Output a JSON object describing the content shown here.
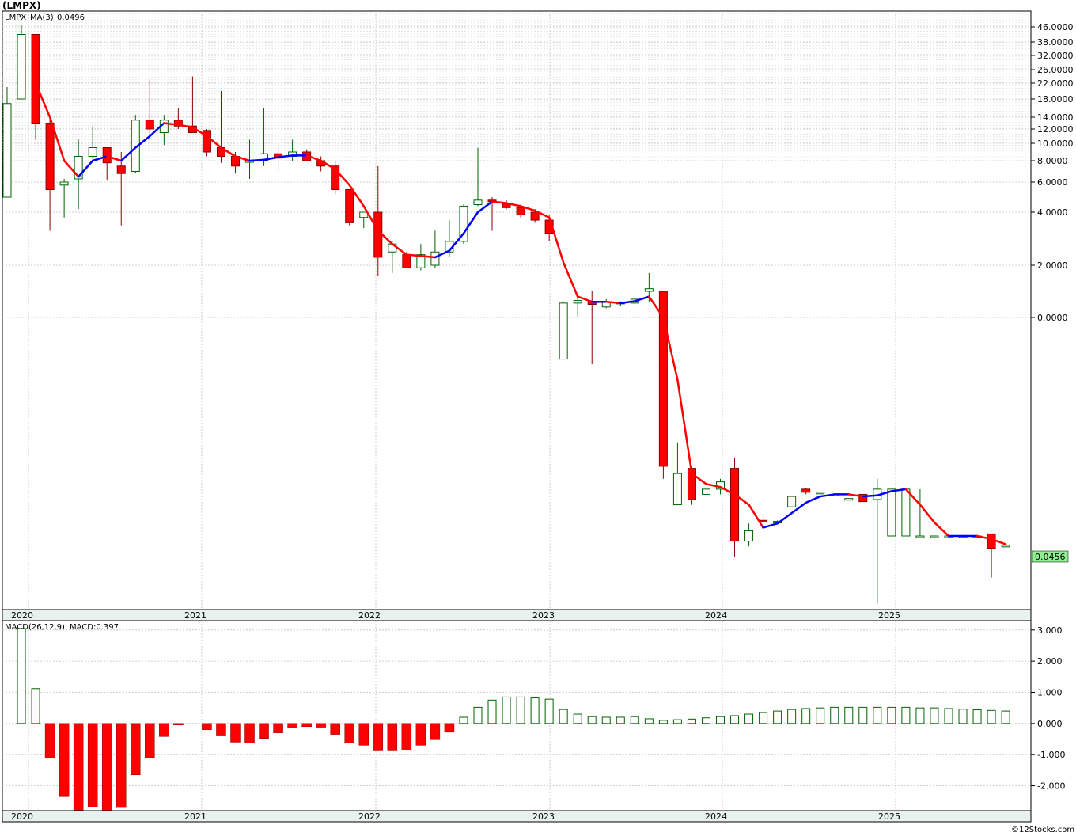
{
  "title": "(LMPX)",
  "footer": "©12Stocks.com",
  "colors": {
    "up": "#006400",
    "down": "#ff0000",
    "ma_up": "#0000ff",
    "ma_down": "#ff0000",
    "grid": "#c0c0c0",
    "axis_bg": "#e8f0f0",
    "price_tag": "#90ee90"
  },
  "chart_data": [
    {
      "type": "candlestick",
      "legend": {
        "symbol": "LMPX",
        "ma_label": "MA(3)",
        "ma_value": "0.0496"
      },
      "last_price_label": "0.0456",
      "ytick_labels": [
        "46.0000",
        "38.0000",
        "32.0000",
        "26.0000",
        "22.0000",
        "18.0000",
        "14.0000",
        "12.0000",
        "10.0000",
        "8.0000",
        "6.0000",
        "4.0000",
        "2.0000",
        "0.0000"
      ],
      "ytick_values": [
        46,
        38,
        32,
        26,
        22,
        18,
        14,
        12,
        10,
        8,
        6,
        4,
        2,
        0
      ],
      "year_labels": [
        "2020",
        "2021",
        "2022",
        "2023",
        "2024",
        "2025"
      ],
      "scale_note": "non-linear price axis",
      "candles": [
        {
          "o": 5.0,
          "h": 21.0,
          "l": 5.0,
          "c": 17.0
        },
        {
          "o": 18.0,
          "h": 50.0,
          "l": 18.0,
          "c": 42.0
        },
        {
          "o": 42.0,
          "h": 42.0,
          "l": 10.5,
          "c": 13.0
        },
        {
          "o": 13.0,
          "h": 13.5,
          "l": 3.3,
          "c": 5.5
        },
        {
          "o": 5.8,
          "h": 6.3,
          "l": 3.8,
          "c": 6.0
        },
        {
          "o": 6.3,
          "h": 10.5,
          "l": 4.2,
          "c": 8.5
        },
        {
          "o": 8.5,
          "h": 12.5,
          "l": 8.2,
          "c": 9.5
        },
        {
          "o": 9.5,
          "h": 9.5,
          "l": 6.2,
          "c": 7.8
        },
        {
          "o": 7.5,
          "h": 9.0,
          "l": 3.5,
          "c": 6.8
        },
        {
          "o": 7.0,
          "h": 14.5,
          "l": 6.8,
          "c": 13.5
        },
        {
          "o": 13.5,
          "h": 23.0,
          "l": 11.0,
          "c": 12.0
        },
        {
          "o": 11.5,
          "h": 14.5,
          "l": 9.8,
          "c": 13.5
        },
        {
          "o": 13.5,
          "h": 16.0,
          "l": 12.0,
          "c": 12.5
        },
        {
          "o": 12.5,
          "h": 24.0,
          "l": 11.5,
          "c": 11.5
        },
        {
          "o": 11.8,
          "h": 12.0,
          "l": 8.5,
          "c": 9.0
        },
        {
          "o": 9.5,
          "h": 20.0,
          "l": 7.8,
          "c": 8.5
        },
        {
          "o": 8.5,
          "h": 9.0,
          "l": 6.8,
          "c": 7.5
        },
        {
          "o": 8.0,
          "h": 10.5,
          "l": 6.3,
          "c": 8.0
        },
        {
          "o": 8.0,
          "h": 16.0,
          "l": 7.5,
          "c": 8.8
        },
        {
          "o": 8.8,
          "h": 9.5,
          "l": 7.0,
          "c": 8.3
        },
        {
          "o": 8.5,
          "h": 10.5,
          "l": 8.0,
          "c": 9.0
        },
        {
          "o": 9.0,
          "h": 9.3,
          "l": 8.0,
          "c": 8.0
        },
        {
          "o": 8.0,
          "h": 8.5,
          "l": 7.0,
          "c": 7.5
        },
        {
          "o": 7.5,
          "h": 8.0,
          "l": 5.2,
          "c": 5.5
        },
        {
          "o": 5.5,
          "h": 5.5,
          "l": 3.5,
          "c": 3.6
        },
        {
          "o": 3.8,
          "h": 4.0,
          "l": 3.4,
          "c": 4.0
        },
        {
          "o": 4.0,
          "h": 7.5,
          "l": 1.6,
          "c": 2.3
        },
        {
          "o": 2.5,
          "h": 2.9,
          "l": 1.7,
          "c": 2.8
        },
        {
          "o": 2.4,
          "h": 2.5,
          "l": 1.9,
          "c": 1.9
        },
        {
          "o": 1.9,
          "h": 2.8,
          "l": 1.8,
          "c": 2.4
        },
        {
          "o": 2.0,
          "h": 3.3,
          "l": 1.9,
          "c": 2.5
        },
        {
          "o": 2.5,
          "h": 3.7,
          "l": 2.3,
          "c": 2.9
        },
        {
          "o": 2.9,
          "h": 4.5,
          "l": 2.8,
          "c": 4.4
        },
        {
          "o": 4.5,
          "h": 9.5,
          "l": 4.4,
          "c": 4.8
        },
        {
          "o": 4.8,
          "h": 5.0,
          "l": 3.3,
          "c": 4.7
        },
        {
          "o": 4.6,
          "h": 4.8,
          "l": 4.2,
          "c": 4.3
        },
        {
          "o": 4.3,
          "h": 4.5,
          "l": 3.8,
          "c": 3.9
        },
        {
          "o": 4.0,
          "h": 4.2,
          "l": 3.6,
          "c": 3.7
        },
        {
          "o": 3.7,
          "h": 3.9,
          "l": 2.9,
          "c": 3.2
        },
        {
          "o": -0.4,
          "h": 0.6,
          "l": -0.4,
          "c": 0.55
        },
        {
          "o": 0.55,
          "h": 0.75,
          "l": 0.0,
          "c": 0.65
        },
        {
          "o": 0.6,
          "h": 1.0,
          "l": -0.45,
          "c": 0.5
        },
        {
          "o": 0.4,
          "h": 0.7,
          "l": 0.35,
          "c": 0.6
        },
        {
          "o": 0.55,
          "h": 0.62,
          "l": 0.45,
          "c": 0.58
        },
        {
          "o": 0.55,
          "h": 0.75,
          "l": 0.5,
          "c": 0.7
        },
        {
          "o": 1.0,
          "h": 1.7,
          "l": 0.6,
          "c": 1.1
        },
        {
          "o": 1.0,
          "h": 1.0,
          "l": -1.55,
          "c": -1.43
        },
        {
          "o": -1.8,
          "h": -1.2,
          "l": -1.8,
          "c": -1.5
        },
        {
          "o": -1.45,
          "h": -1.42,
          "l": -1.8,
          "c": -1.75
        },
        {
          "o": -1.7,
          "h": -1.65,
          "l": -1.7,
          "c": -1.65
        },
        {
          "o": -1.65,
          "h": -1.55,
          "l": -1.7,
          "c": -1.58
        },
        {
          "o": -1.45,
          "h": -1.35,
          "l": -2.3,
          "c": -2.15
        },
        {
          "o": -2.15,
          "h": -1.98,
          "l": -2.2,
          "c": -2.05
        },
        {
          "o": -1.95,
          "h": -1.9,
          "l": -1.98,
          "c": -1.96
        },
        {
          "o": -1.97,
          "h": -1.95,
          "l": -1.97,
          "c": -1.96
        },
        {
          "o": -1.82,
          "h": -1.72,
          "l": -1.82,
          "c": -1.72
        },
        {
          "o": -1.65,
          "h": -1.64,
          "l": -1.7,
          "c": -1.68
        },
        {
          "o": -1.68,
          "h": -1.68,
          "l": -1.68,
          "c": -1.68
        },
        {
          "o": -1.7,
          "h": -1.7,
          "l": -1.7,
          "c": -1.7
        },
        {
          "o": -1.74,
          "h": -1.74,
          "l": -1.74,
          "c": -1.74
        },
        {
          "o": -1.7,
          "h": -1.7,
          "l": -1.77,
          "c": -1.77
        },
        {
          "o": -1.75,
          "h": -1.55,
          "l": -2.75,
          "c": -1.65
        },
        {
          "o": -2.1,
          "h": -1.65,
          "l": -2.1,
          "c": -1.65
        },
        {
          "o": -2.1,
          "h": -1.65,
          "l": -2.1,
          "c": -1.65
        },
        {
          "o": -2.1,
          "h": -1.65,
          "l": -2.1,
          "c": -2.1
        },
        {
          "o": -2.1,
          "h": -2.1,
          "l": -2.1,
          "c": -2.1
        },
        {
          "o": -2.1,
          "h": -2.09,
          "l": -2.1,
          "c": -2.1
        },
        {
          "o": -2.1,
          "h": -2.1,
          "l": -2.1,
          "c": -2.1
        },
        {
          "o": -2.1,
          "h": -2.1,
          "l": -2.1,
          "c": -2.1
        },
        {
          "o": -2.08,
          "h": -2.08,
          "l": -2.5,
          "c": -2.22
        },
        {
          "o": -2.19,
          "h": -2.18,
          "l": -2.2,
          "c": -2.19
        }
      ],
      "ma3": [
        null,
        null,
        22.0,
        14.0,
        8.0,
        6.5,
        8.0,
        8.5,
        8.0,
        9.5,
        11.0,
        13.0,
        12.7,
        12.3,
        11.0,
        9.5,
        8.5,
        8.0,
        8.1,
        8.4,
        8.6,
        8.6,
        8.0,
        7.2,
        5.8,
        4.4,
        3.3,
        2.8,
        2.4,
        2.35,
        2.3,
        2.55,
        3.2,
        4.0,
        4.7,
        4.6,
        4.4,
        4.1,
        3.8,
        2.1,
        0.8,
        0.6,
        0.6,
        0.55,
        0.62,
        0.8,
        0.0,
        -0.6,
        -1.5,
        -1.6,
        -1.63,
        -1.7,
        -1.8,
        -2.02,
        -1.98,
        -1.88,
        -1.78,
        -1.72,
        -1.7,
        -1.7,
        -1.72,
        -1.71,
        -1.67,
        -1.65,
        -1.8,
        -1.97,
        -2.1,
        -2.1,
        -2.1,
        -2.13,
        -2.18
      ]
    },
    {
      "type": "bar",
      "legend": {
        "label": "MACD(26,12,9)",
        "value_label": "MACD:0.397"
      },
      "ytick_labels": [
        "3.000",
        "2.000",
        "1.000",
        "0.000",
        "-1.000",
        "-2.000"
      ],
      "ytick_values": [
        3,
        2,
        1,
        0,
        -1,
        -2
      ],
      "ylim": [
        -2.8,
        3.3
      ],
      "year_labels": [
        "2020",
        "2021",
        "2022",
        "2023",
        "2024",
        "2025"
      ],
      "values": [
        0,
        3.05,
        1.12,
        -1.1,
        -2.35,
        -2.82,
        -2.68,
        -2.82,
        -2.7,
        -1.65,
        -1.1,
        -0.42,
        -0.05,
        0.0,
        -0.2,
        -0.4,
        -0.6,
        -0.62,
        -0.48,
        -0.3,
        -0.15,
        -0.1,
        -0.12,
        -0.35,
        -0.62,
        -0.7,
        -0.88,
        -0.88,
        -0.85,
        -0.7,
        -0.52,
        -0.28,
        0.2,
        0.52,
        0.75,
        0.85,
        0.85,
        0.82,
        0.78,
        0.45,
        0.3,
        0.22,
        0.2,
        0.2,
        0.22,
        0.15,
        0.1,
        0.12,
        0.14,
        0.18,
        0.22,
        0.25,
        0.3,
        0.35,
        0.4,
        0.45,
        0.48,
        0.5,
        0.52,
        0.52,
        0.52,
        0.52,
        0.52,
        0.52,
        0.5,
        0.5,
        0.48,
        0.46,
        0.44,
        0.42,
        0.4
      ]
    }
  ]
}
